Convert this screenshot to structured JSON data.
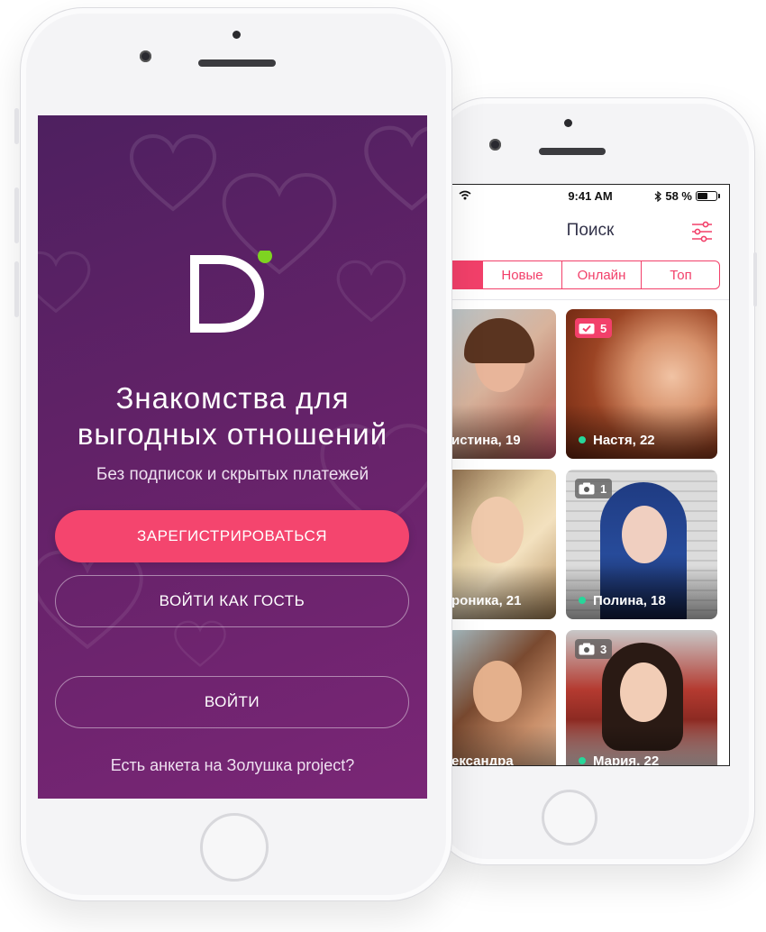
{
  "colors": {
    "accent": "#f4456e",
    "purple_dark": "#4e2060",
    "purple_light": "#7a2676",
    "online": "#27d79a",
    "logo_dot": "#7ed321"
  },
  "front_screen": {
    "logo_letter": "D",
    "headline_line1": "Знакомства для",
    "headline_line2": "выгодных отношений",
    "subline": "Без подписок и скрытых платежей",
    "register_button": "ЗАРЕГИСТРИРОВАТЬСЯ",
    "guest_button": "ВОЙТИ КАК ГОСТЬ",
    "login_button": "ВОЙТИ",
    "footer_link": "Есть анкета на Золушка project?"
  },
  "back_screen": {
    "status": {
      "time": "9:41 AM",
      "battery": "58 %",
      "icons": [
        "wifi-icon",
        "bluetooth-icon",
        "battery-icon"
      ]
    },
    "nav_title": "Поиск",
    "tabs": [
      "",
      "Новые",
      "Онлайн",
      "Топ"
    ],
    "profiles": [
      {
        "name": "истина, 19",
        "online": false,
        "badge": null
      },
      {
        "name": "Настя, 22",
        "online": true,
        "badge": {
          "icon": "check-photo-icon",
          "count": "5"
        }
      },
      {
        "name": "роника, 21",
        "online": false,
        "badge": null
      },
      {
        "name": "Полина, 18",
        "online": true,
        "badge": {
          "icon": "camera-icon",
          "count": "1"
        }
      },
      {
        "name": "ександра",
        "online": false,
        "badge": null
      },
      {
        "name": "Мария, 22",
        "online": true,
        "badge": {
          "icon": "camera-icon",
          "count": "3"
        }
      }
    ]
  }
}
